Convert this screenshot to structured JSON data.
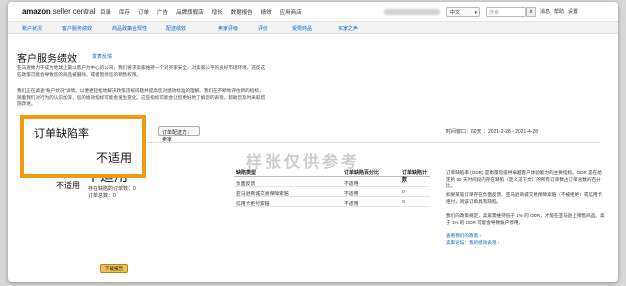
{
  "topnav": {
    "logo_main": "amazon",
    "logo_sub": "seller central",
    "links": [
      "目录",
      "库存",
      "订单",
      "广告",
      "品牌旗舰店",
      "增长",
      "数据报告",
      "绩效",
      "应用商店"
    ],
    "language": "中文",
    "search_placeholder": "搜索",
    "right_links": [
      "消息",
      "帮助",
      "设置"
    ]
  },
  "subnav": {
    "items": [
      "账户状况",
      "客户服务绩效",
      "商品政策合规性",
      "配送绩效",
      "卖家评级",
      "评价",
      "受限商品",
      "买家之声"
    ]
  },
  "page": {
    "title": "客户服务绩效",
    "title_link": "发表反馈",
    "intro": "亚马逊致力于成为地球上最以客户为中心的公司，我们要求卖家维持一个对买家安全、对卖家公平的良好市场环境。违反这些政策可能会导致您的商品被删除，或者暂停您的销售权限。",
    "intro2": "我们正在调查“账户状况”详情。以便更轻松地解决政策违规问题并提高您对绩效标准的理解。我们在不断地评估新的指标，随着我们对行为的认识加深，您的绩效指标可能会发生变化。这些指标可能会让您更好地了解您的表现，帮助您及时采取措施改进。"
  },
  "filter": {
    "label": "订单配送方：卖家",
    "period": "时间窗口：60天 ：2021-2-28 - 2021-4-28"
  },
  "metric": {
    "value": "不适用",
    "left_value": "不适用",
    "sub1": "存在缺陷的订单数：0",
    "sub2": "订单总数：0"
  },
  "overlay": {
    "title": "订单缺陷率",
    "value": "不适用"
  },
  "table": {
    "headers": [
      "缺陷类型",
      "订单缺陷百分比",
      "订单缺陷计数"
    ],
    "rows": [
      [
        "负面反馈",
        "不适用",
        "0"
      ],
      [
        "亚马逊商城交易保障索赔",
        "不适用",
        "0"
      ],
      [
        "信用卡拒付索赔",
        "不适用",
        "0"
      ]
    ]
  },
  "description": {
    "p1": "订单缺陷率 (ODR) 是衡量您提供卓越客户体验能力的主要指标。ODR 是在给定的 60 天时间段内存在缺陷（定义见下文）的所有订单数占订单总数的百分比。",
    "p2": "如果某笔订单存在负面反馈、亚马逊商城交易保障索赔（不被拒绝）或信用卡拒付，则该订单具有缺陷。",
    "p3": "我们的政策规定，卖家需维持低于 1% 的 ODR，才能在亚马逊上销售商品。高于 1% 的 ODR 可能会导致账户停用。",
    "link1": "查看我们的政策 ›",
    "link2": "卖家论坛：我的绩效表现 ›"
  },
  "download_label": "下载报告",
  "watermark": "样张仅供参考"
}
